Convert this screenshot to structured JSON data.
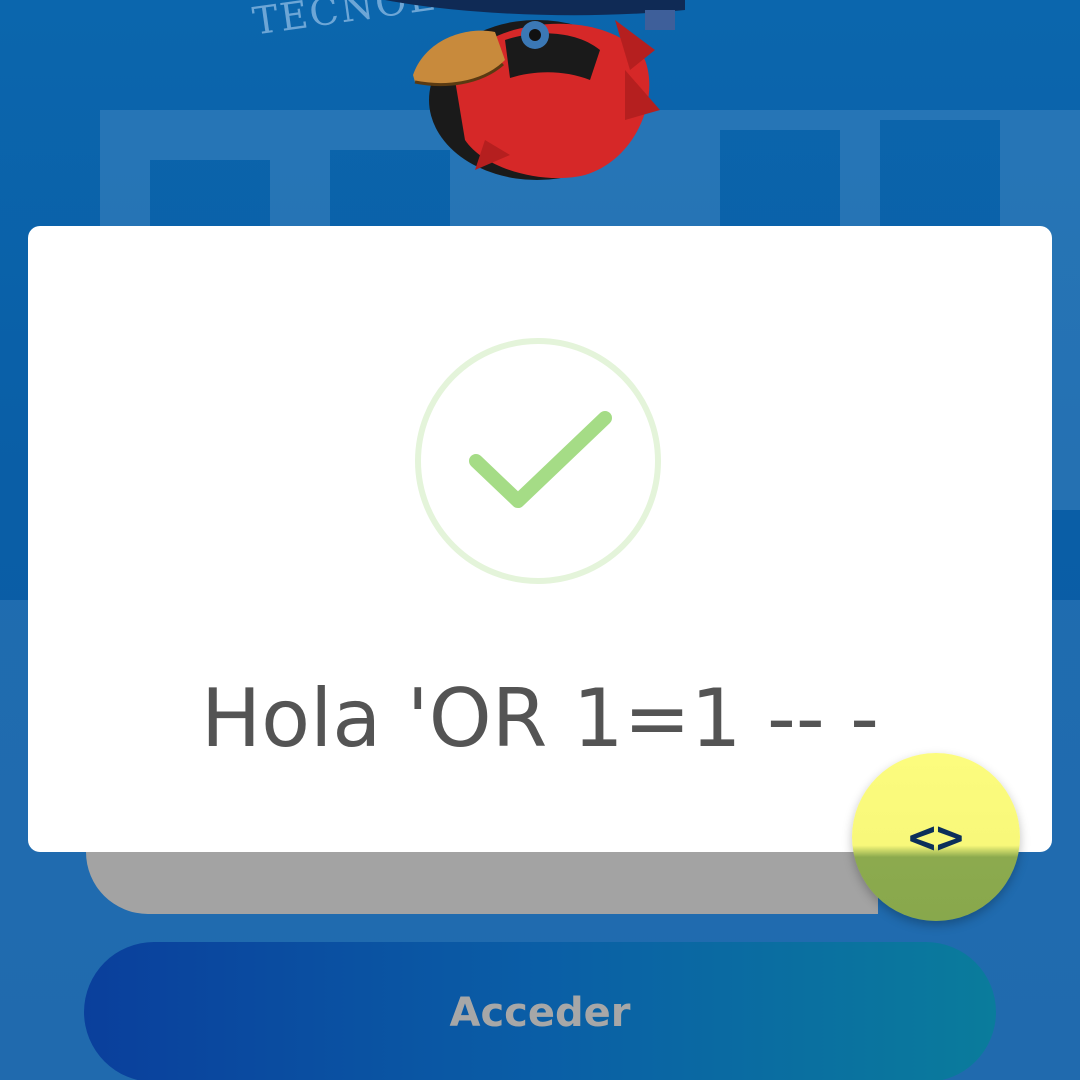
{
  "background": {
    "sign_text": "TECNOLÓGICOS SUPERIORES DE"
  },
  "login_form": {
    "password_mask": "............",
    "submit_label": "Acceder"
  },
  "dialog": {
    "icon": "success-check-icon",
    "message": "Hola 'OR 1=1 -- -"
  },
  "fab": {
    "icon": "code-brackets-icon",
    "glyph": "<>"
  },
  "colors": {
    "background_blue": "#0b66ad",
    "check_green": "#a5dc86",
    "fab_yellow": "#fcfc7e",
    "message_gray": "#545454"
  }
}
